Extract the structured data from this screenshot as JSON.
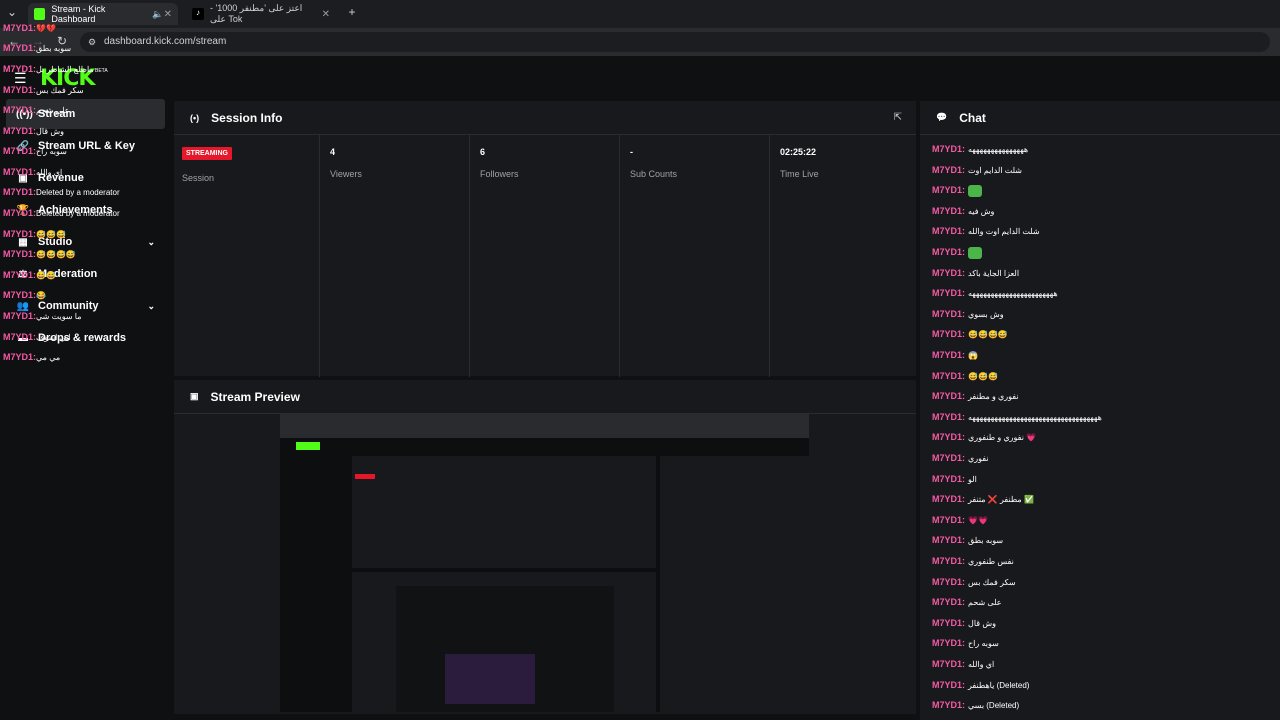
{
  "browser": {
    "tabs": [
      {
        "label": "Stream - Kick Dashboard"
      },
      {
        "label": "اعتز على 'مطنفر 1000' - على Tok"
      }
    ],
    "new_tab": "+",
    "url": "dashboard.kick.com/stream"
  },
  "brand": {
    "logo": "KICK",
    "beta": "BETA",
    "accent": "#53fc18"
  },
  "sidebar": {
    "items": [
      {
        "label": "Stream",
        "icon": "broadcast-icon"
      },
      {
        "label": "Stream URL & Key",
        "icon": "link-icon"
      },
      {
        "label": "Revenue",
        "icon": "dollar-icon"
      },
      {
        "label": "Achievements",
        "icon": "trophy-icon"
      },
      {
        "label": "Studio",
        "icon": "studio-icon"
      },
      {
        "label": "Moderation",
        "icon": "gavel-icon"
      },
      {
        "label": "Community",
        "icon": "users-icon"
      },
      {
        "label": "Drops & rewards",
        "icon": "gift-icon"
      }
    ]
  },
  "left_chat": [
    {
      "user": "M7YD1:",
      "text": "💔💔"
    },
    {
      "user": "M7YD1:",
      "text": "سوبه بطق"
    },
    {
      "user": "M7YD1:",
      "text": "ماطلع الشاطر بل"
    },
    {
      "user": "M7YD1:",
      "text": "سكر فمك بس"
    },
    {
      "user": "M7YD1:",
      "text": "على شحم"
    },
    {
      "user": "M7YD1:",
      "text": "وش قال"
    },
    {
      "user": "M7YD1:",
      "text": "سوبه راح"
    },
    {
      "user": "M7YD1:",
      "text": "اي والله"
    },
    {
      "user": "M7YD1:",
      "text": "Deleted by a moderator"
    },
    {
      "user": "M7YD1:",
      "text": "Deleted by a moderator"
    },
    {
      "user": "M7YD1:",
      "text": "😅😅😅"
    },
    {
      "user": "M7YD1:",
      "text": "😅😅😅😅"
    },
    {
      "user": "M7YD1:",
      "text": "😅😅"
    },
    {
      "user": "M7YD1:",
      "text": "😂"
    },
    {
      "user": "M7YD1:",
      "text": "ما سويت شي"
    },
    {
      "user": "M7YD1:",
      "text": "ابي اشوف"
    },
    {
      "user": "M7YD1:",
      "text": "مي مي"
    }
  ],
  "session": {
    "title": "Session Info",
    "status": "STREAMING",
    "stats": [
      {
        "value": "",
        "label": "Session"
      },
      {
        "value": "4",
        "label": "Viewers"
      },
      {
        "value": "6",
        "label": "Followers"
      },
      {
        "value": "-",
        "label": "Sub Counts"
      },
      {
        "value": "02:25:22",
        "label": "Time Live"
      }
    ]
  },
  "preview": {
    "title": "Stream Preview"
  },
  "chat": {
    "title": "Chat",
    "messages": [
      {
        "user": "M7YD1:",
        "text": "هههههههههههههههه"
      },
      {
        "user": "M7YD1:",
        "text": "شلت الدايم اوت"
      },
      {
        "user": "M7YD1:",
        "text": ""
      },
      {
        "user": "M7YD1:",
        "text": "وش فيه"
      },
      {
        "user": "M7YD1:",
        "text": "شلت الدايم اوت والله"
      },
      {
        "user": "M7YD1:",
        "text": ""
      },
      {
        "user": "M7YD1:",
        "text": "العزا الجاية باكد"
      },
      {
        "user": "M7YD1:",
        "text": "هههههههههههههههههههههههه"
      },
      {
        "user": "M7YD1:",
        "text": "وش بسوي"
      },
      {
        "user": "M7YD1:",
        "text": "😅😅😅😅"
      },
      {
        "user": "M7YD1:",
        "text": "😱"
      },
      {
        "user": "M7YD1:",
        "text": "😅😅😅"
      },
      {
        "user": "M7YD1:",
        "text": "نفوري و مطنفر"
      },
      {
        "user": "M7YD1:",
        "text": "هههههههههههههههههههههههههههههههههههه"
      },
      {
        "user": "M7YD1:",
        "text": "نفوري و طنفوري 💗"
      },
      {
        "user": "M7YD1:",
        "text": "نفوري"
      },
      {
        "user": "M7YD1:",
        "text": "الو"
      },
      {
        "user": "M7YD1:",
        "text": "مطنفر ❌ متنفر ✅"
      },
      {
        "user": "M7YD1:",
        "text": "💗💗"
      },
      {
        "user": "M7YD1:",
        "text": "سوبه بطق"
      },
      {
        "user": "M7YD1:",
        "text": "نفس طنفوري"
      },
      {
        "user": "M7YD1:",
        "text": "سكر فمك بس"
      },
      {
        "user": "M7YD1:",
        "text": "على شحم"
      },
      {
        "user": "M7YD1:",
        "text": "وش قال"
      },
      {
        "user": "M7YD1:",
        "text": "سوبه راح"
      },
      {
        "user": "M7YD1:",
        "text": "اي والله"
      },
      {
        "user": "M7YD1:",
        "text": "ياهطنفر (Deleted)"
      },
      {
        "user": "M7YD1:",
        "text": "بسي (Deleted)"
      }
    ]
  }
}
